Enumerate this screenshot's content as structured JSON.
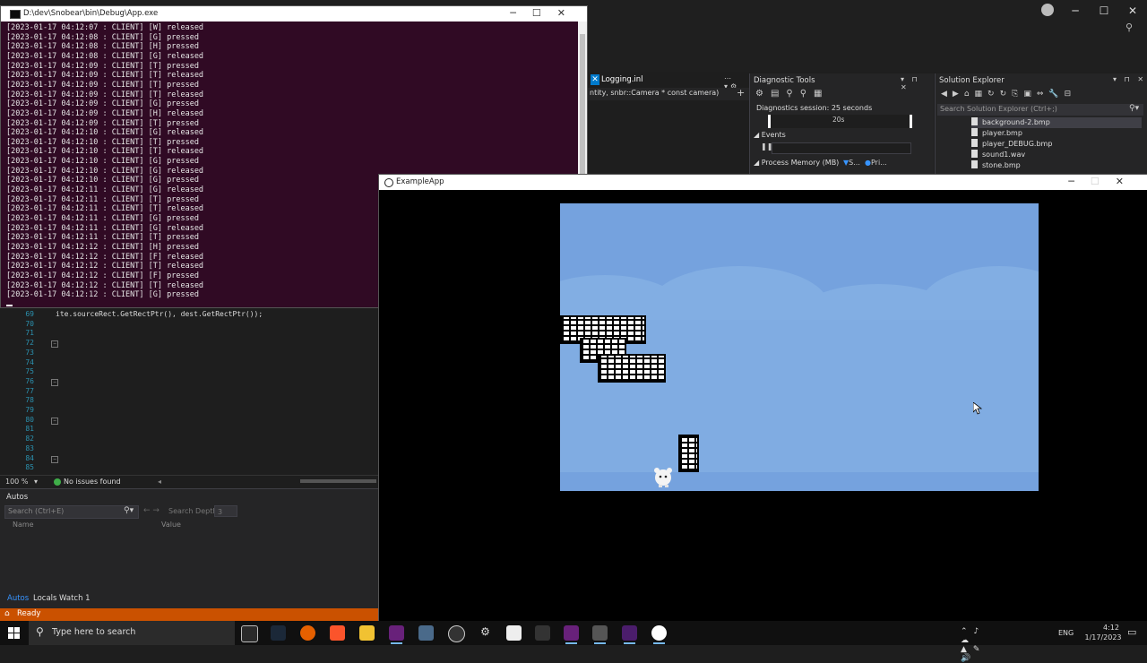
{
  "console": {
    "title": "D:\\dev\\Snobear\\bin\\Debug\\App.exe",
    "lines": [
      "[2023-01-17 04:12:07 : CLIENT] [W] released",
      "[2023-01-17 04:12:08 : CLIENT] [G] pressed",
      "[2023-01-17 04:12:08 : CLIENT] [H] pressed",
      "[2023-01-17 04:12:08 : CLIENT] [G] released",
      "[2023-01-17 04:12:09 : CLIENT] [T] pressed",
      "[2023-01-17 04:12:09 : CLIENT] [T] released",
      "[2023-01-17 04:12:09 : CLIENT] [T] pressed",
      "[2023-01-17 04:12:09 : CLIENT] [T] released",
      "[2023-01-17 04:12:09 : CLIENT] [G] pressed",
      "[2023-01-17 04:12:09 : CLIENT] [H] released",
      "[2023-01-17 04:12:09 : CLIENT] [T] pressed",
      "[2023-01-17 04:12:10 : CLIENT] [G] released",
      "[2023-01-17 04:12:10 : CLIENT] [T] pressed",
      "[2023-01-17 04:12:10 : CLIENT] [T] released",
      "[2023-01-17 04:12:10 : CLIENT] [G] pressed",
      "[2023-01-17 04:12:10 : CLIENT] [G] released",
      "[2023-01-17 04:12:10 : CLIENT] [G] pressed",
      "[2023-01-17 04:12:11 : CLIENT] [G] released",
      "[2023-01-17 04:12:11 : CLIENT] [T] pressed",
      "[2023-01-17 04:12:11 : CLIENT] [T] released",
      "[2023-01-17 04:12:11 : CLIENT] [G] pressed",
      "[2023-01-17 04:12:11 : CLIENT] [G] released",
      "[2023-01-17 04:12:11 : CLIENT] [T] pressed",
      "[2023-01-17 04:12:12 : CLIENT] [H] pressed",
      "[2023-01-17 04:12:12 : CLIENT] [F] released",
      "[2023-01-17 04:12:12 : CLIENT] [T] released",
      "[2023-01-17 04:12:12 : CLIENT] [F] pressed",
      "[2023-01-17 04:12:12 : CLIENT] [T] released",
      "[2023-01-17 04:12:12 : CLIENT] [G] pressed"
    ]
  },
  "editor": {
    "lines": [
      {
        "num": "69",
        "code": "ite.sourceRect.GetRectPtr(), dest.GetRectPtr());",
        "fold": false
      },
      {
        "num": "70",
        "code": "",
        "fold": false
      },
      {
        "num": "71",
        "code": "",
        "fold": false
      },
      {
        "num": "72",
        "code": "",
        "fold": true
      },
      {
        "num": "73",
        "code": "",
        "fold": false
      },
      {
        "num": "74",
        "code": "",
        "fold": false
      },
      {
        "num": "75",
        "code": "",
        "fold": false
      },
      {
        "num": "76",
        "code": "",
        "fold": true
      },
      {
        "num": "77",
        "code": "",
        "fold": false
      },
      {
        "num": "78",
        "code": "",
        "fold": false
      },
      {
        "num": "79",
        "code": "",
        "fold": false
      },
      {
        "num": "80",
        "code": "",
        "fold": true
      },
      {
        "num": "81",
        "code": "",
        "fold": false
      },
      {
        "num": "82",
        "code": "",
        "fold": false
      },
      {
        "num": "83",
        "code": "",
        "fold": false
      },
      {
        "num": "84",
        "code": "",
        "fold": true
      },
      {
        "num": "85",
        "code": "",
        "fold": false
      }
    ],
    "zoom": "100 %",
    "issues": "No issues found"
  },
  "autos": {
    "title": "Autos",
    "search_placeholder": "Search (Ctrl+E)",
    "depth_label": "Search Depth:",
    "depth_value": "3",
    "col_name": "Name",
    "col_value": "Value",
    "tabs": [
      "Autos",
      "Locals",
      "Watch 1"
    ]
  },
  "status": {
    "text": "Ready"
  },
  "doc_tab": {
    "label": "Logging.inl",
    "nav": "ntity, snbr::Camera * const camera)"
  },
  "diagnostics": {
    "title": "Diagnostic Tools",
    "session": "Diagnostics session: 25 seconds",
    "timeline_label": "20s",
    "events": "Events",
    "memory": "Process Memory (MB)",
    "legend1": "S...",
    "legend2": "Pri..."
  },
  "solution": {
    "title": "Solution Explorer",
    "search_placeholder": "Search Solution Explorer (Ctrl+;)",
    "files": [
      "background-2.bmp",
      "player.bmp",
      "player_DEBUG.bmp",
      "sound1.wav",
      "stone.bmp"
    ]
  },
  "game": {
    "title": "ExampleApp"
  },
  "taskbar": {
    "search_placeholder": "Type here to search",
    "lang": "ENG",
    "time": "4:12",
    "date": "1/17/2023"
  },
  "colors": {
    "console_bg": "#300a24",
    "sky": "#75a2de",
    "status_bar": "#ca5100",
    "vs_accent": "#007acc"
  }
}
